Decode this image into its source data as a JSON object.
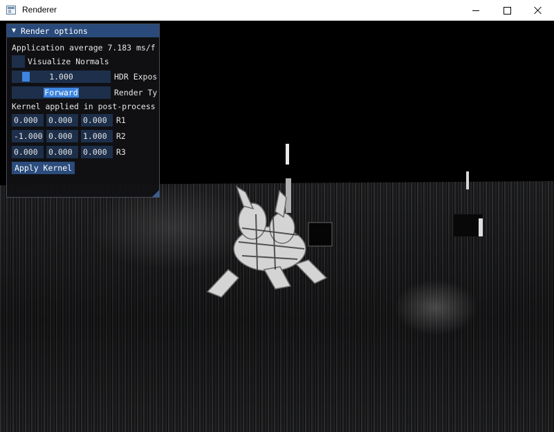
{
  "window": {
    "title": "Renderer"
  },
  "panel": {
    "title": "Render options",
    "perf_text": "Application average 7.183 ms/f",
    "normals_checkbox_label": "Visualize Normals",
    "normals_checked": false,
    "hdr_exposure": {
      "value": "1.000",
      "label": "HDR Expos"
    },
    "render_type": {
      "selected": "Forward",
      "label": "Render Ty"
    },
    "kernel_heading": "Kernel applied in post-process",
    "kernel_rows": [
      {
        "label": "R1",
        "values": [
          "0.000",
          "0.000",
          "0.000"
        ]
      },
      {
        "label": "R2",
        "values": [
          "-1.000",
          "0.000",
          "1.000"
        ]
      },
      {
        "label": "R3",
        "values": [
          "0.000",
          "0.000",
          "0.000"
        ]
      }
    ],
    "apply_button_label": "Apply Kernel"
  },
  "colors": {
    "panel_header": "#294a7a",
    "widget_frame": "#1d2f4a",
    "accent": "#3d85e0",
    "viewport_bg": "#000000"
  }
}
